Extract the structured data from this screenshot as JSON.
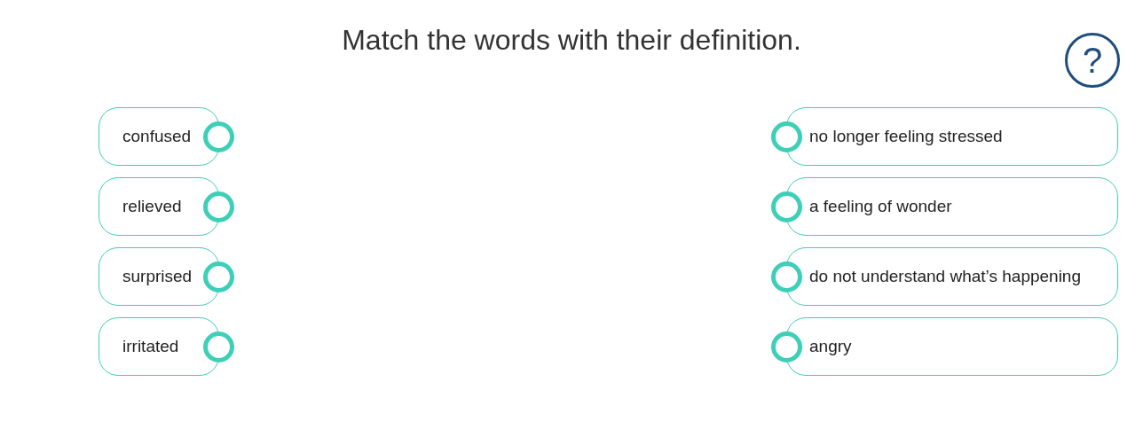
{
  "instruction": "Match the words with their definition.",
  "help_button": {
    "label": "?"
  },
  "words": [
    {
      "label": "confused"
    },
    {
      "label": "relieved"
    },
    {
      "label": "surprised"
    },
    {
      "label": "irritated"
    }
  ],
  "definitions": [
    {
      "label": "no longer feeling stressed"
    },
    {
      "label": "a feeling of wonder"
    },
    {
      "label": "do not understand what’s happening"
    },
    {
      "label": "angry"
    }
  ]
}
